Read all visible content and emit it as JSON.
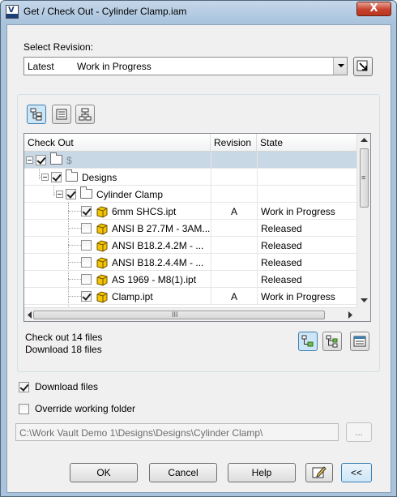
{
  "window": {
    "title": "Get / Check Out - Cylinder Clamp.iam",
    "close_glyph": "X",
    "app_icon_text": "V",
    "app_icon_badge": "PRO"
  },
  "revision": {
    "label": "Select Revision:",
    "selected_revision": "Latest",
    "selected_state": "Work in Progress"
  },
  "grid": {
    "columns": [
      "Check Out",
      "Revision",
      "State"
    ],
    "rows": [
      {
        "name": "$",
        "revision": "",
        "state": "",
        "checked": true,
        "type": "folder",
        "level": 0,
        "selected": true
      },
      {
        "name": "Designs",
        "revision": "",
        "state": "",
        "checked": true,
        "type": "folder",
        "level": 1
      },
      {
        "name": "Cylinder Clamp",
        "revision": "",
        "state": "",
        "checked": true,
        "type": "folder",
        "level": 2
      },
      {
        "name": "6mm SHCS.ipt",
        "revision": "A",
        "state": "Work in Progress",
        "checked": true,
        "type": "part",
        "level": 3
      },
      {
        "name": "ANSI B 27.7M - 3AM...",
        "revision": "",
        "state": "Released",
        "checked": false,
        "type": "part",
        "level": 3
      },
      {
        "name": "ANSI B18.2.4.2M - ...",
        "revision": "",
        "state": "Released",
        "checked": false,
        "type": "part",
        "level": 3
      },
      {
        "name": "ANSI B18.2.4.4M - ...",
        "revision": "",
        "state": "Released",
        "checked": false,
        "type": "part",
        "level": 3
      },
      {
        "name": "AS 1969 - M8(1).ipt",
        "revision": "",
        "state": "Released",
        "checked": false,
        "type": "part",
        "level": 3
      },
      {
        "name": "Clamp.ipt",
        "revision": "A",
        "state": "Work in Progress",
        "checked": true,
        "type": "part",
        "level": 3
      }
    ],
    "hscroll_grip": "III",
    "vscroll_grip": "≡"
  },
  "summary": {
    "checkout": "Check out 14 files",
    "download": "Download 18 files"
  },
  "options": {
    "download_files_label": "Download files",
    "download_files_checked": true,
    "override_label": "Override working folder",
    "override_checked": false
  },
  "working_folder": {
    "path": "C:\\Work Vault Demo 1\\Designs\\Designs\\Cylinder Clamp\\",
    "browse_label": "..."
  },
  "buttons": {
    "ok": "OK",
    "cancel": "Cancel",
    "help": "Help",
    "collapse": "<<"
  },
  "colors": {
    "accent": "#3c7fb1",
    "selection": "#c9d8e5",
    "frame": "#a9c3dc"
  }
}
